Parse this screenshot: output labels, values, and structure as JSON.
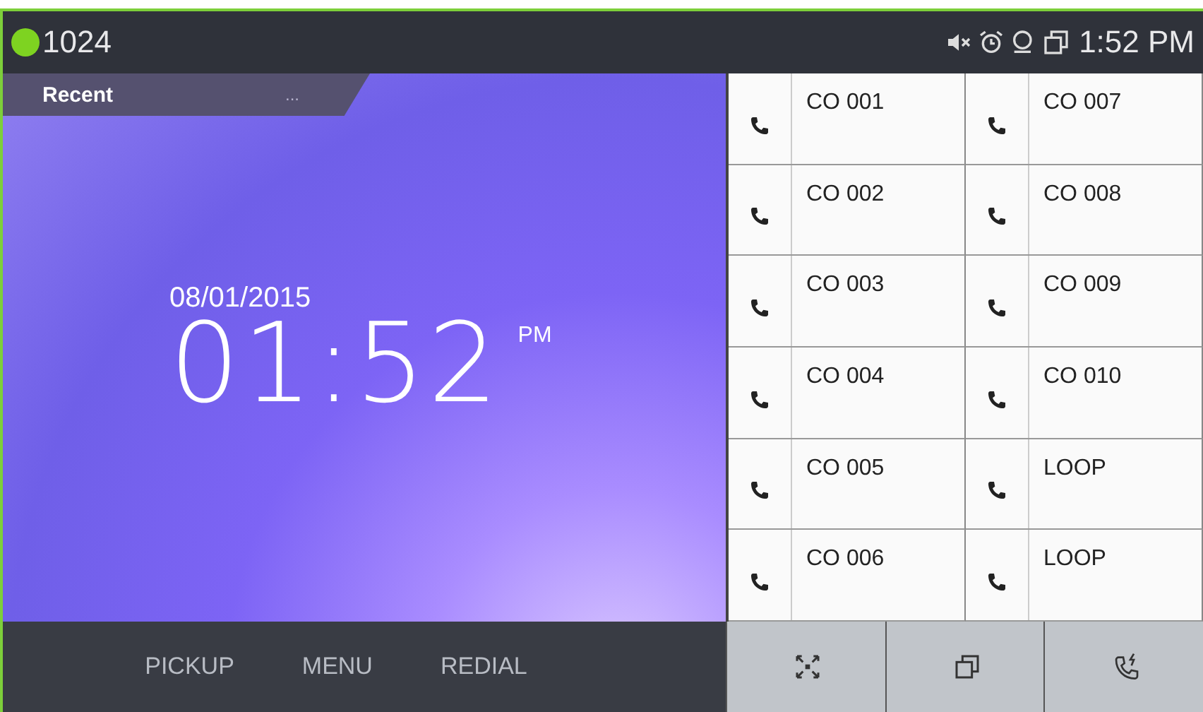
{
  "status_bar": {
    "extension": "1024",
    "registered": true,
    "time": "1:52 PM"
  },
  "recent_tab": {
    "label": "Recent",
    "more": "..."
  },
  "clock": {
    "date": "08/01/2015",
    "time": "01:52",
    "meridiem": "PM"
  },
  "softkeys": [
    "PICKUP",
    "MENU",
    "REDIAL"
  ],
  "line_keys": [
    {
      "label": "CO 001"
    },
    {
      "label": "CO 002"
    },
    {
      "label": "CO 003"
    },
    {
      "label": "CO 004"
    },
    {
      "label": "CO 005"
    },
    {
      "label": "CO 006"
    },
    {
      "label": "CO 007"
    },
    {
      "label": "CO 008"
    },
    {
      "label": "CO 009"
    },
    {
      "label": "CO 010"
    },
    {
      "label": "LOOP"
    },
    {
      "label": "LOOP"
    }
  ]
}
